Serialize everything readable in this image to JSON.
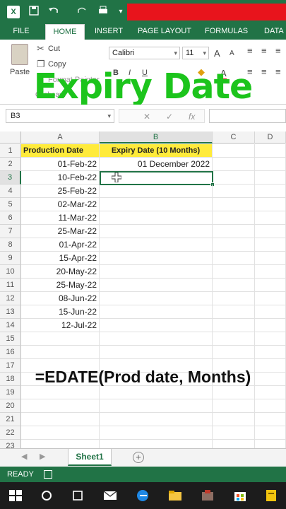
{
  "colors": {
    "excel_green": "#217346",
    "header_yellow": "#ffeb3b",
    "title_green": "#1cc41c",
    "title_bar_red": "#e8141c"
  },
  "titlebar": {
    "app_icon": "excel-logo-icon",
    "app_letter": "X",
    "qat_caret": "▾"
  },
  "ribbon_tabs": {
    "file": "FILE",
    "items": [
      "HOME",
      "INSERT",
      "PAGE LAYOUT",
      "FORMULAS",
      "DATA"
    ]
  },
  "ribbon": {
    "clipboard": {
      "cut": "Cut",
      "copy": "Copy",
      "paste": "Paste",
      "format_painter": "Format Painter",
      "group": "Clipboard"
    },
    "font": {
      "name": "Calibri",
      "size": "11",
      "bold": "B",
      "italic": "I",
      "underline": "U",
      "grow": "A",
      "shrink": "A"
    }
  },
  "overlay_title": "Expiry Date",
  "formula_bar": {
    "name_box": "B3",
    "cancel": "✕",
    "enter": "✓",
    "fx": "fx",
    "value": ""
  },
  "sheet": {
    "columns": [
      "A",
      "B",
      "C",
      "D"
    ],
    "headers": {
      "a": "Production Date",
      "b": "Expiry Date (10 Months)"
    },
    "rows": [
      {
        "num": "1"
      },
      {
        "num": "2",
        "a": "01-Feb-22",
        "b": "01 December 2022"
      },
      {
        "num": "3",
        "a": "10-Feb-22",
        "b": ""
      },
      {
        "num": "4",
        "a": "25-Feb-22"
      },
      {
        "num": "5",
        "a": "02-Mar-22"
      },
      {
        "num": "6",
        "a": "11-Mar-22"
      },
      {
        "num": "7",
        "a": "25-Mar-22"
      },
      {
        "num": "8",
        "a": "01-Apr-22"
      },
      {
        "num": "9",
        "a": "15-Apr-22"
      },
      {
        "num": "10",
        "a": "20-May-22"
      },
      {
        "num": "11",
        "a": "25-May-22"
      },
      {
        "num": "12",
        "a": "08-Jun-22"
      },
      {
        "num": "13",
        "a": "15-Jun-22"
      },
      {
        "num": "14",
        "a": "12-Jul-22"
      },
      {
        "num": "15"
      },
      {
        "num": "16"
      },
      {
        "num": "17"
      },
      {
        "num": "18"
      },
      {
        "num": "19"
      },
      {
        "num": "20"
      },
      {
        "num": "21"
      },
      {
        "num": "22"
      },
      {
        "num": "23"
      }
    ]
  },
  "formula_overlay": "=EDATE(Prod date, Months)",
  "sheet_tabs": {
    "active": "Sheet1",
    "add": "+"
  },
  "status": {
    "mode": "READY"
  }
}
